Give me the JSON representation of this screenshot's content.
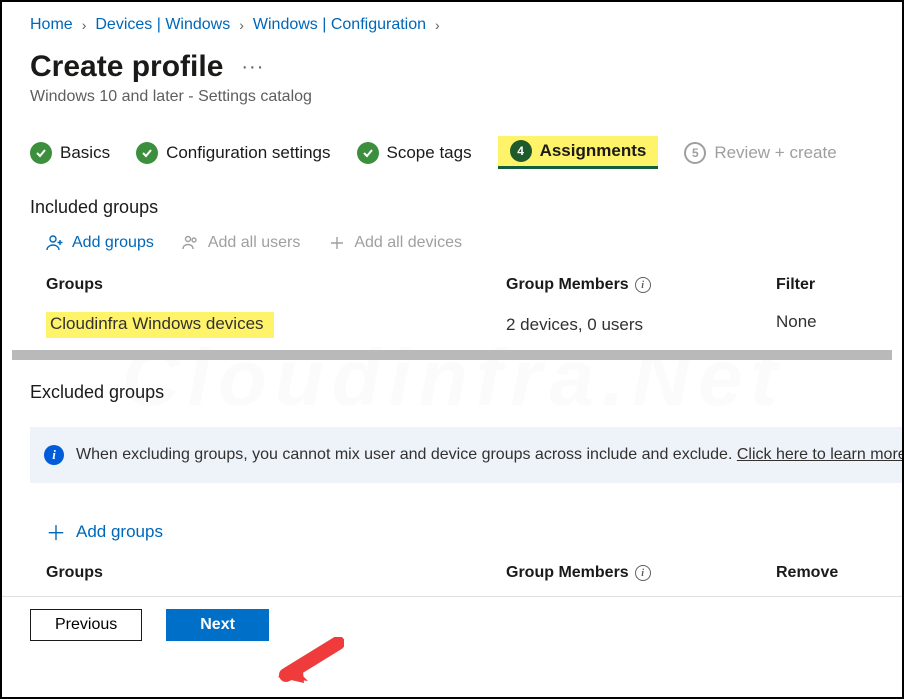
{
  "breadcrumb": {
    "home": "Home",
    "devices": "Devices | Windows",
    "windows": "Windows | Configuration"
  },
  "header": {
    "title": "Create profile",
    "subtitle": "Windows 10 and later - Settings catalog"
  },
  "steps": {
    "basics": "Basics",
    "config": "Configuration settings",
    "scope": "Scope tags",
    "assign_num": "4",
    "assign": "Assignments",
    "review_num": "5",
    "review": "Review + create"
  },
  "included": {
    "heading": "Included groups",
    "add_groups": "Add groups",
    "add_users": "Add all users",
    "add_devices": "Add all devices",
    "col_groups": "Groups",
    "col_members": "Group Members",
    "col_filter": "Filter",
    "row_name": "Cloudinfra Windows devices",
    "row_members": "2 devices, 0 users",
    "row_filter": "None"
  },
  "excluded": {
    "heading": "Excluded groups",
    "info_text": "When excluding groups, you cannot mix user and device groups across include and exclude. ",
    "info_link": "Click here to learn more about excluding groups.",
    "add_groups": "Add groups",
    "col_groups": "Groups",
    "col_members": "Group Members",
    "col_remove": "Remove"
  },
  "footer": {
    "prev": "Previous",
    "next": "Next"
  }
}
